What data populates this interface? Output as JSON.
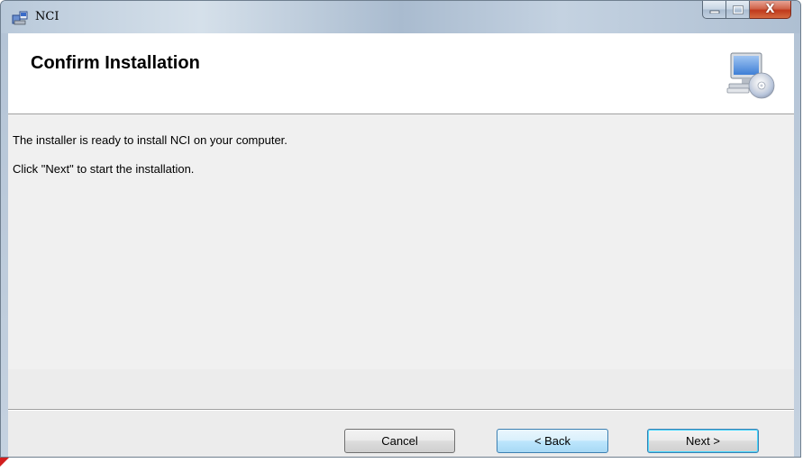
{
  "window": {
    "title": "NCI",
    "icon": "installer-icon",
    "caption_buttons": {
      "minimize_icon": "minimize-icon",
      "maximize_icon": "maximize-icon",
      "close_label": "X"
    }
  },
  "header": {
    "title": "Confirm Installation",
    "icon": "computer-cd-icon"
  },
  "body": {
    "line1": "The installer is ready to install NCI on your computer.",
    "line2": "Click \"Next\" to start the installation."
  },
  "buttons": {
    "cancel": "Cancel",
    "back": "< Back",
    "next": "Next >"
  },
  "colors": {
    "close_button": "#c0391c",
    "focus_border": "#3c7fb1"
  }
}
